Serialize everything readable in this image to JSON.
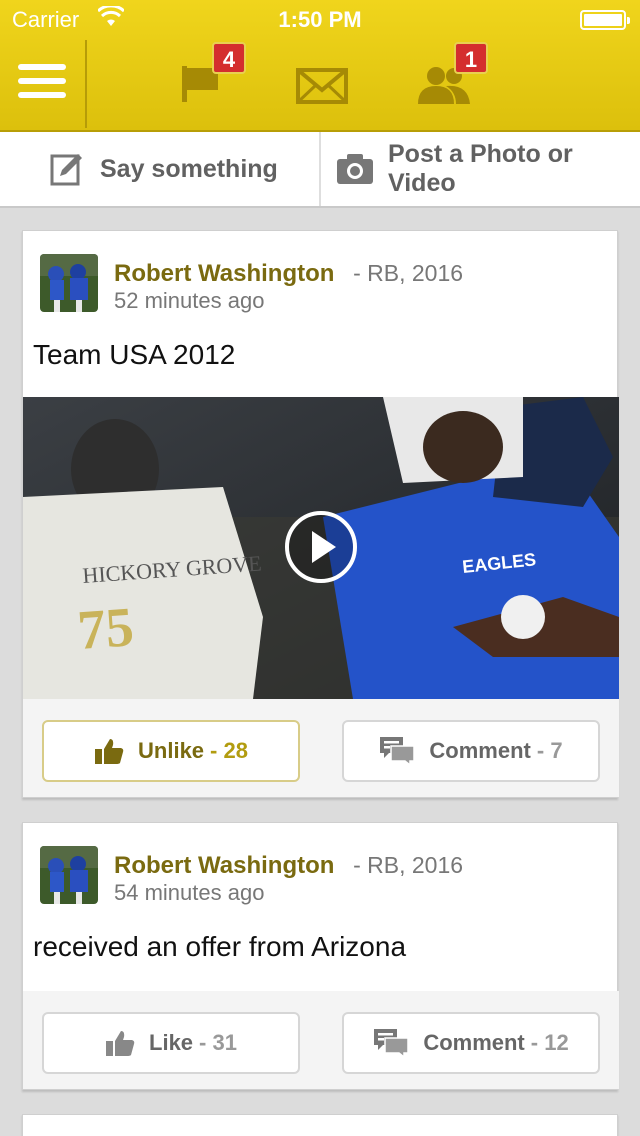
{
  "status_bar": {
    "carrier": "Carrier",
    "time": "1:50 PM"
  },
  "header": {
    "flag_badge": "4",
    "friends_badge": "1",
    "icons": [
      "menu-icon",
      "flag-icon",
      "mail-icon",
      "friends-icon"
    ]
  },
  "post_bar": {
    "say_label": "Say something",
    "photo_label": "Post a Photo or Video"
  },
  "colors": {
    "header": "#e6c914",
    "accent": "#7a6a10",
    "badge": "#d42e2e"
  },
  "posts": [
    {
      "author": "Robert Washington",
      "meta": "- RB, 2016",
      "time": "52 minutes ago",
      "text": "Team USA 2012",
      "has_video": true,
      "like_label": "Unlike",
      "like_count": "- 28",
      "comment_label": "Comment",
      "comment_count": "- 7"
    },
    {
      "author": "Robert Washington",
      "meta": "- RB, 2016",
      "time": "54 minutes ago",
      "text": "received an offer from Arizona",
      "has_video": false,
      "like_label": "Like",
      "like_count": "- 31",
      "comment_label": "Comment",
      "comment_count": "- 12"
    }
  ]
}
